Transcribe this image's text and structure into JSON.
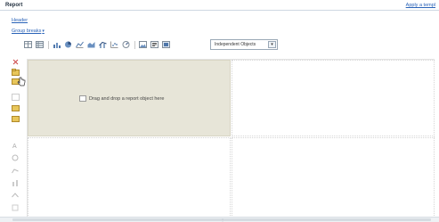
{
  "header": {
    "title": "Report",
    "apply_link": "Apply a templ"
  },
  "links": {
    "header": "Header",
    "group_breaks": "Group breaks",
    "group_breaks_caret": "▾"
  },
  "toolbar": {
    "buttons": [
      "table-icon",
      "crosstab-icon",
      "bar-chart-icon",
      "pie-chart-icon",
      "line-chart-icon",
      "area-chart-icon",
      "combo-chart-icon",
      "scatter-chart-icon",
      "gauge-icon",
      "image-icon",
      "text-icon",
      "map-icon"
    ]
  },
  "view_select": {
    "value": "Independent Objects",
    "arrow": "▾"
  },
  "left_rail": {
    "icons": [
      "close-icon",
      "folder-icon",
      "cursor-hand-icon",
      "blank-icon",
      "folder-icon",
      "folder-icon",
      "text-icon",
      "chart-icon",
      "chart-icon",
      "chart-icon",
      "chart-icon",
      "chart-icon"
    ]
  },
  "drop_area": {
    "label": "Drag and drop a report object here"
  },
  "colors": {
    "link": "#2a63b8",
    "drop_bg": "#e7e5d8",
    "border": "#cfd8e2"
  }
}
